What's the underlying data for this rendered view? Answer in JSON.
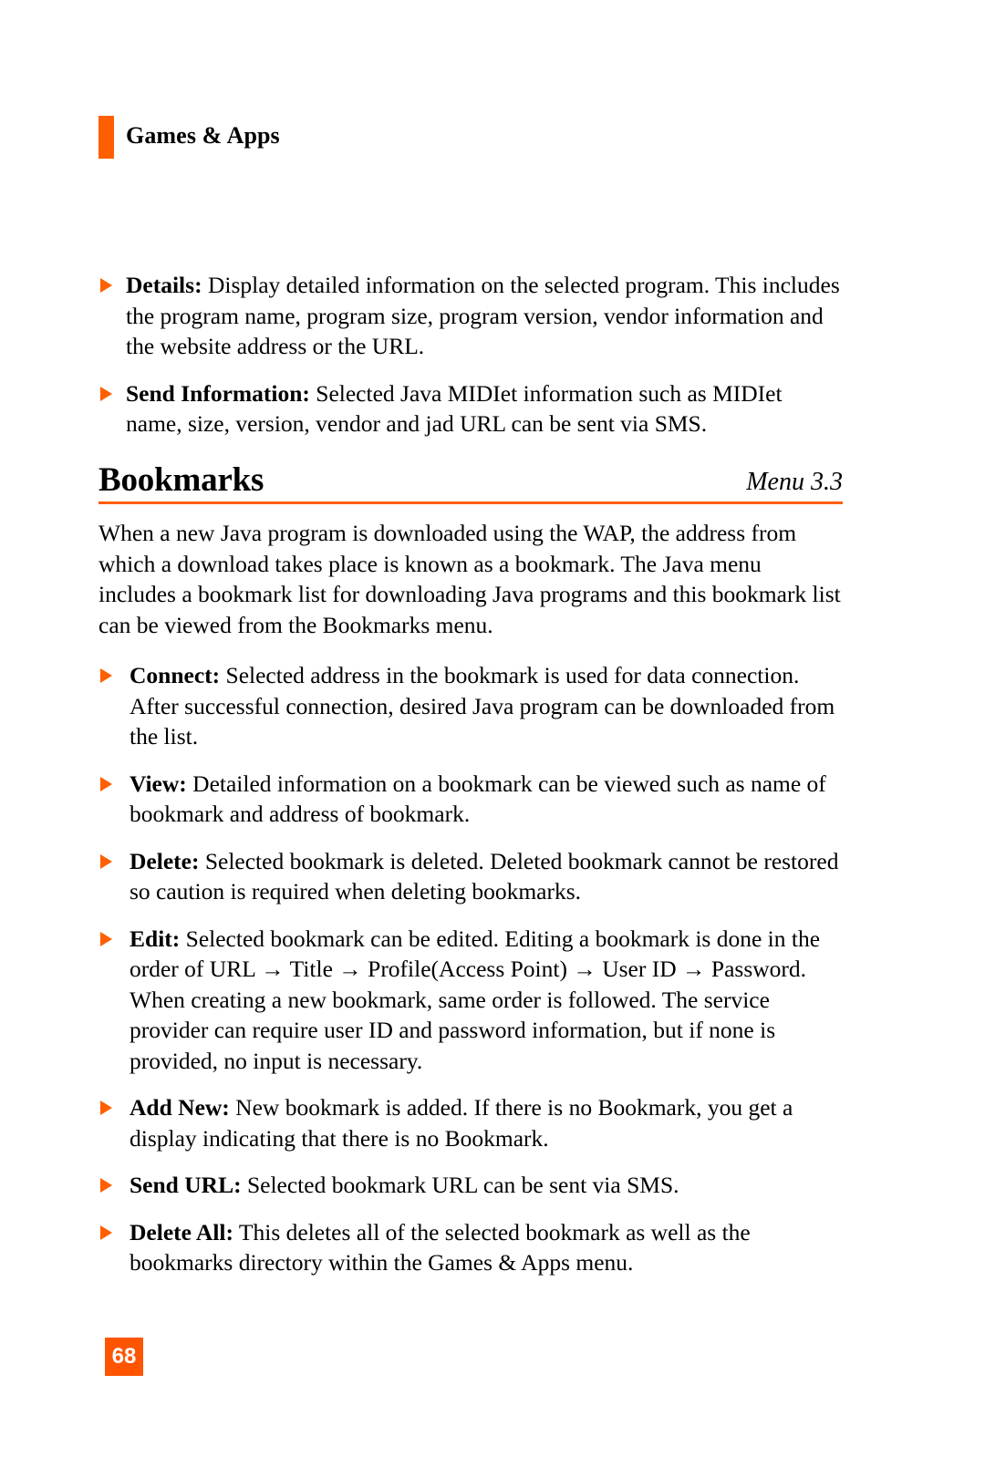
{
  "document": {
    "header": {
      "chapter_title": "Games & Apps",
      "accent_color": "#FF5F00"
    },
    "page_number": "68",
    "top_bullets": [
      {
        "term": "Details:",
        "text": " Display detailed information on the selected program. This includes the program name, program size, program version, vendor information and the website address or the URL."
      },
      {
        "term": "Send Information:",
        "text": " Selected Java MIDIet information such as MIDIet name, size, version, vendor and jad URL can be sent via SMS."
      }
    ],
    "section": {
      "title": "Bookmarks",
      "menu_label": "Menu 3.3",
      "intro": "When a new Java program is downloaded using the WAP, the address from which a download takes place is known as a bookmark. The Java menu includes a bookmark list for downloading Java programs and this bookmark list can be viewed from the Bookmarks menu.",
      "bullets": [
        {
          "term": "Connect:",
          "text": " Selected address in the bookmark is used for data connection. After successful connection, desired Java program can be downloaded from the list."
        },
        {
          "term": "View:",
          "text": " Detailed information on a bookmark can be viewed such as name of bookmark and address of bookmark."
        },
        {
          "term": "Delete:",
          "text": " Selected bookmark is deleted. Deleted bookmark cannot be restored so caution is required when deleting bookmarks."
        },
        {
          "term": "Edit:",
          "text": " Selected bookmark can be edited. Editing a bookmark is done in the order of URL → Title → Profile(Access Point) → User ID → Password. When creating a new bookmark, same order is followed. The service provider can require user ID and password information, but if none is provided, no input is necessary."
        },
        {
          "term": "Add New:",
          "text": " New bookmark is added. If there is no Bookmark, you get a display indicating that there is no Bookmark."
        },
        {
          "term": "Send URL:",
          "text": " Selected bookmark URL can be sent via SMS."
        },
        {
          "term": "Delete All:",
          "text": " This deletes all of the selected bookmark as well as the bookmarks directory within the Games & Apps menu."
        }
      ]
    }
  }
}
